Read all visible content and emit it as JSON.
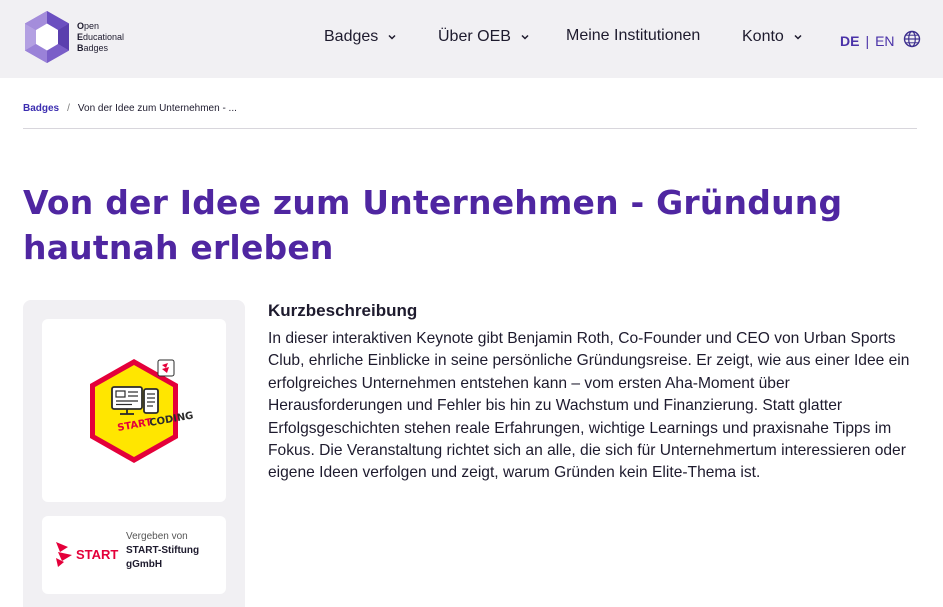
{
  "header": {
    "logo": {
      "line1_initial": "O",
      "line1_rest": "pen",
      "line2_initial": "E",
      "line2_rest": "ducational",
      "line3_initial": "B",
      "line3_rest": "adges"
    },
    "nav": [
      {
        "label": "Badges",
        "has_dropdown": true
      },
      {
        "label": "Über OEB",
        "has_dropdown": true
      },
      {
        "label": "Meine Institutionen",
        "has_dropdown": false
      },
      {
        "label": "Konto",
        "has_dropdown": true
      }
    ],
    "language": {
      "active": "DE",
      "separator": "|",
      "other": "EN",
      "icon": "globe-icon"
    }
  },
  "breadcrumb": {
    "root": "Badges",
    "separator": "/",
    "current": "Von der Idee zum Unternehmen - ..."
  },
  "page": {
    "title": "Von der Idee zum Unternehmen - Gründung hautnah erleben"
  },
  "badge": {
    "image_text_start": "START",
    "image_text_coding": "CODING",
    "icon": "start-coding-badge-icon"
  },
  "issuer": {
    "label": "Vergeben von",
    "name": "START-Stiftung gGmbH",
    "logo_word": "START"
  },
  "description": {
    "heading": "Kurzbeschreibung",
    "text": "In dieser interaktiven Keynote gibt Benjamin Roth, Co-Founder und CEO von Urban Sports Club, ehrliche Einblicke in seine persönliche Gründungsreise. Er zeigt, wie aus einer Idee ein erfolgreiches Unternehmen entstehen kann – vom ersten Aha-Moment über Herausforderungen und Fehler bis hin zu Wachstum und Finanzierung. Statt glatter Erfolgsgeschichten stehen reale Erfahrungen, wichtige Learnings und praxisnahe Tipps im Fokus. Die Veranstaltung richtet sich an alle, die sich für Unternehmertum interessieren oder eigene Ideen verfolgen und zeigt, warum Gründen kein Elite-Thema ist."
  },
  "colors": {
    "brand_purple": "#4f26a1",
    "header_bg": "#f1f0f3",
    "badge_yellow": "#ffe600",
    "badge_red": "#e4003a"
  }
}
